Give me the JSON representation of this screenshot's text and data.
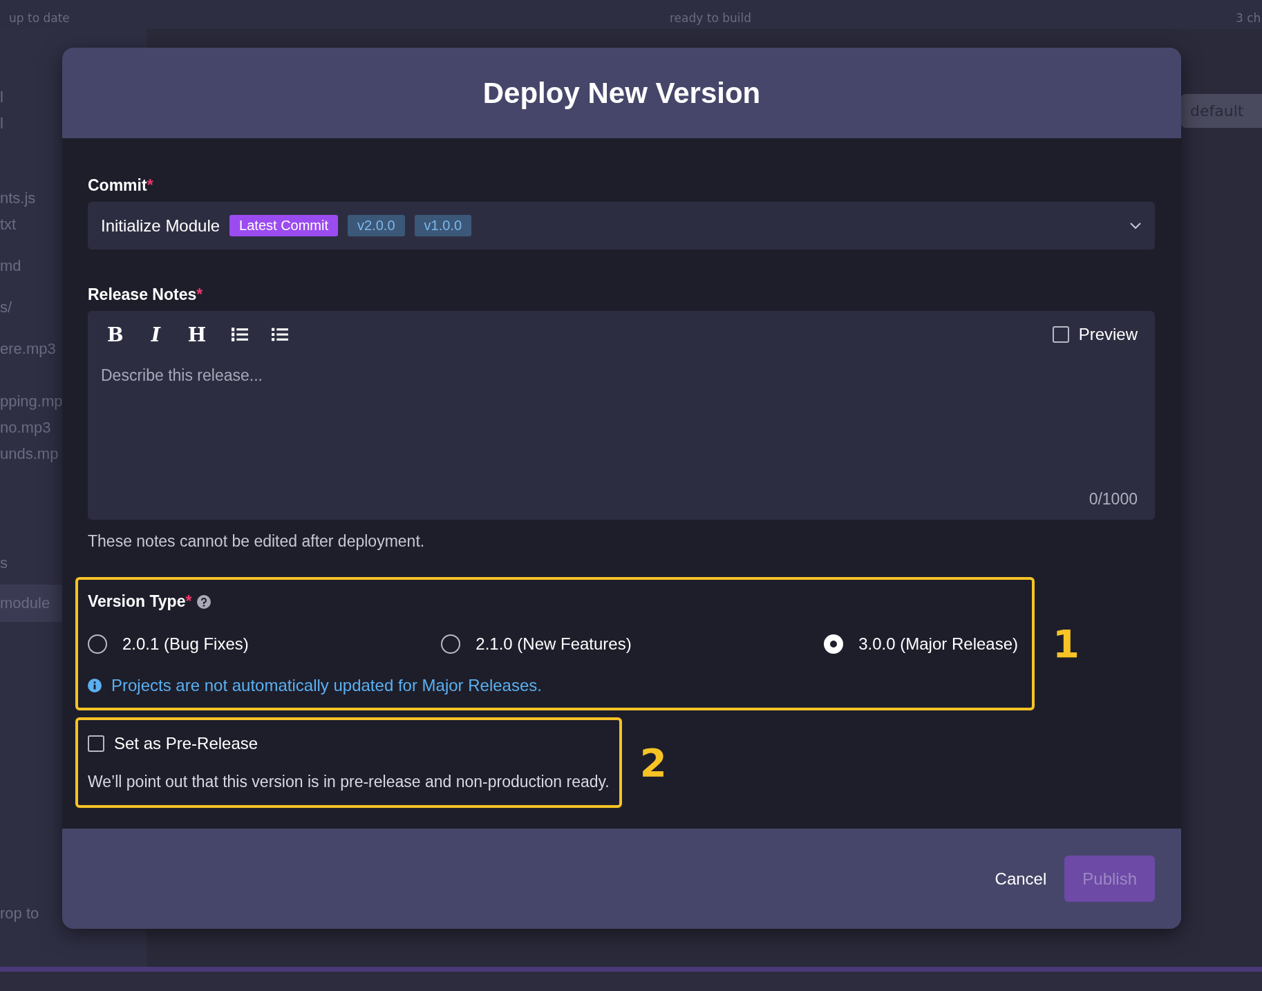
{
  "background": {
    "top_bar": {
      "left_status": "up to date",
      "center_status": "ready to build",
      "right_status": "3 ch"
    },
    "sidebar": {
      "items": [
        {
          "label": "l",
          "selected": false
        },
        {
          "label": "l",
          "selected": false
        },
        {
          "label": "nts.js",
          "selected": false
        },
        {
          "label": "txt",
          "selected": false
        },
        {
          "label": "md",
          "selected": false
        },
        {
          "label": "s/",
          "selected": false
        },
        {
          "label": "ere.mp3",
          "selected": false
        },
        {
          "label": "pping.mp",
          "selected": false
        },
        {
          "label": "no.mp3",
          "selected": false
        },
        {
          "label": "unds.mp",
          "selected": false
        },
        {
          "label": "s",
          "selected": false
        },
        {
          "label": "module",
          "selected": true
        }
      ],
      "footer": "rop to"
    },
    "branch_select": "default"
  },
  "dialog": {
    "title": "Deploy New Version",
    "required_mark": "*",
    "commit": {
      "label": "Commit",
      "required": true,
      "value": "Initialize Module",
      "tags": [
        {
          "text": "Latest Commit",
          "kind": "latest"
        },
        {
          "text": "v2.0.0",
          "kind": "version"
        },
        {
          "text": "v1.0.0",
          "kind": "version"
        }
      ]
    },
    "release_notes": {
      "label": "Release Notes",
      "required": true,
      "toolbar": [
        {
          "kind": "bold",
          "label": "B"
        },
        {
          "kind": "italic",
          "label": "I"
        },
        {
          "kind": "heading",
          "label": "H"
        },
        {
          "kind": "ordered_list"
        },
        {
          "kind": "bullet_list"
        }
      ],
      "preview": {
        "label": "Preview",
        "checked": false
      },
      "placeholder": "Describe this release...",
      "counter": "0/1000",
      "hint": "These notes cannot be edited after deployment."
    },
    "version_type": {
      "label": "Version Type",
      "required": true,
      "callout": "1",
      "options": [
        {
          "label": "2.0.1 (Bug Fixes)",
          "selected": false
        },
        {
          "label": "2.1.0 (New Features)",
          "selected": false
        },
        {
          "label": "3.0.0 (Major Release)",
          "selected": true
        }
      ],
      "info": "Projects are not automatically updated for Major Releases."
    },
    "pre_release": {
      "label": "Set as Pre-Release",
      "checked": false,
      "description": "We’ll point out that this version is in pre-release and non-production ready.",
      "callout": "2"
    },
    "buttons": [
      {
        "label": "Cancel",
        "kind": "text",
        "disabled": false
      },
      {
        "label": "Publish",
        "kind": "primary",
        "disabled": true
      }
    ]
  }
}
